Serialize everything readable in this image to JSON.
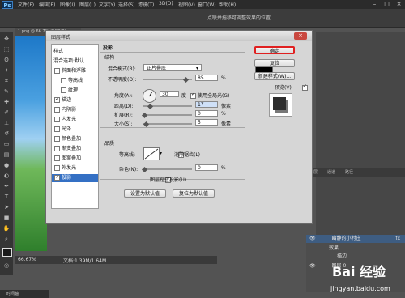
{
  "app": {
    "menu": [
      "文件(F)",
      "编辑(E)",
      "图像(I)",
      "图层(L)",
      "文字(Y)",
      "选择(S)",
      "滤镜(T)",
      "3D(D)",
      "视图(V)",
      "窗口(W)",
      "帮助(H)"
    ],
    "options_hint": "点联并拖移可调整效果的位置",
    "doc_tab": "1.png @ 66.7% (RGB/8)",
    "zoom": "66.67%",
    "doc_info": "文档:1.39M/1.64M",
    "bottom_tab": "时间轴"
  },
  "dialog": {
    "title": "图层样式",
    "styles_header": "样式",
    "blend_options": "混合选项:默认",
    "items": [
      {
        "label": "斜面和浮雕",
        "checked": false
      },
      {
        "label": "等高线",
        "checked": false
      },
      {
        "label": "纹理",
        "checked": false
      },
      {
        "label": "描边",
        "checked": true
      },
      {
        "label": "内阴影",
        "checked": false
      },
      {
        "label": "内发光",
        "checked": false
      },
      {
        "label": "光泽",
        "checked": false
      },
      {
        "label": "颜色叠加",
        "checked": false
      },
      {
        "label": "渐变叠加",
        "checked": false
      },
      {
        "label": "图案叠加",
        "checked": false
      },
      {
        "label": "外发光",
        "checked": false
      },
      {
        "label": "投影",
        "checked": true,
        "selected": true
      }
    ],
    "section_title": "投影",
    "structure_title": "结构",
    "blend_mode_label": "混合模式(B):",
    "blend_mode_value": "正片叠底",
    "opacity_label": "不透明度(O):",
    "opacity_value": "85",
    "angle_label": "角度(A):",
    "angle_value": "30",
    "global_light_label": "使用全局光(G)",
    "distance_label": "距离(D):",
    "distance_value": "17",
    "spread_label": "扩展(R):",
    "spread_value": "0",
    "size_label": "大小(S):",
    "size_value": "5",
    "quality_title": "品质",
    "contour_label": "等高线:",
    "antialias_label": "消除锯齿(L)",
    "noise_label": "杂色(N):",
    "noise_value": "0",
    "knockout_label": "图层挖空投影(U)",
    "set_default": "设置为默认值",
    "reset_default": "复位为默认值",
    "unit_percent": "%",
    "unit_deg": "度",
    "unit_px": "像素",
    "ok": "确定",
    "reset": "复位",
    "new_style": "新建样式(W)...",
    "preview": "预览(V)",
    "shadow_color": "#000000"
  },
  "layers": {
    "tabs": [
      "图层",
      "通道",
      "路径"
    ],
    "layer1": "幽静的小村庄",
    "effects": "效果",
    "stroke": "描边",
    "background": "图层 0"
  },
  "watermark": "jingyan.baidu.com"
}
